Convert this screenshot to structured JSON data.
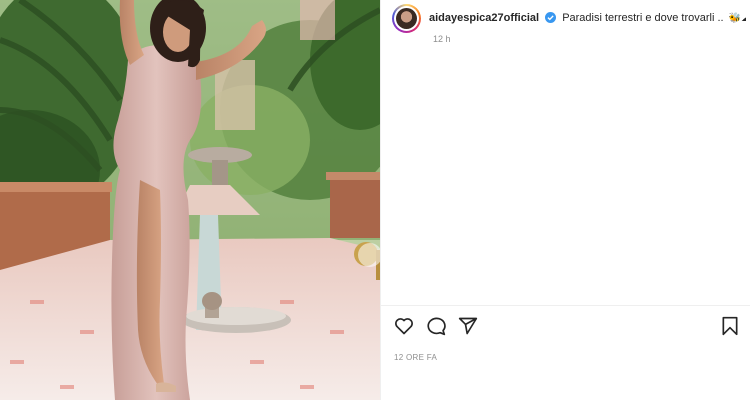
{
  "post": {
    "username": "aidayespica27official",
    "caption": "Paradisi terrestri e dove trovarli ..",
    "caption_emojis": "🐝☁",
    "relative_time_short": "12 h",
    "relative_time_long": "12 ORE FA"
  },
  "icons": {
    "verified": "verified-badge-icon",
    "like": "heart-icon",
    "comment": "comment-icon",
    "share": "share-icon",
    "save": "bookmark-icon"
  },
  "colors": {
    "verified_blue": "#3897f0",
    "meta_text": "#8e8e8e",
    "divider": "#efefef"
  }
}
